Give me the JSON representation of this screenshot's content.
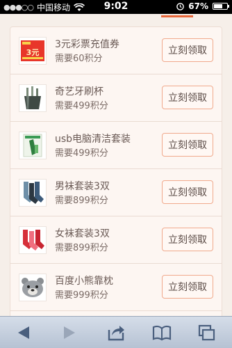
{
  "status_bar": {
    "carrier": "中国移动",
    "signal": "●●●○○",
    "time": "9:02",
    "battery_text": "67%",
    "battery_level": 0.67
  },
  "colors": {
    "accent": "#e8673a",
    "button_border": "#f0a98c",
    "text": "#6a5a55"
  },
  "items": [
    {
      "title": "3元彩票充值券",
      "points": "需要60积分",
      "button": "立刻领取",
      "icon": "lottery-coupon-image",
      "thumb_text": "3元"
    },
    {
      "title": "奇艺牙刷杯",
      "points": "需要499积分",
      "button": "立刻领取",
      "icon": "toothbrush-cup-image"
    },
    {
      "title": "usb电脑清洁套装",
      "points": "需要499积分",
      "button": "立刻领取",
      "icon": "usb-cleaning-kit-image"
    },
    {
      "title": "男袜套装3双",
      "points": "需要899积分",
      "button": "立刻领取",
      "icon": "mens-socks-image"
    },
    {
      "title": "女袜套装3双",
      "points": "需要899积分",
      "button": "立刻领取",
      "icon": "womens-socks-image"
    },
    {
      "title": "百度小熊靠枕",
      "points": "需要999积分",
      "button": "立刻领取",
      "icon": "bear-pillow-image"
    }
  ],
  "toolbar": {
    "back": "back-arrow-icon",
    "forward": "forward-arrow-icon",
    "share": "share-icon",
    "bookmarks": "bookmarks-icon",
    "tabs": "tabs-icon"
  }
}
